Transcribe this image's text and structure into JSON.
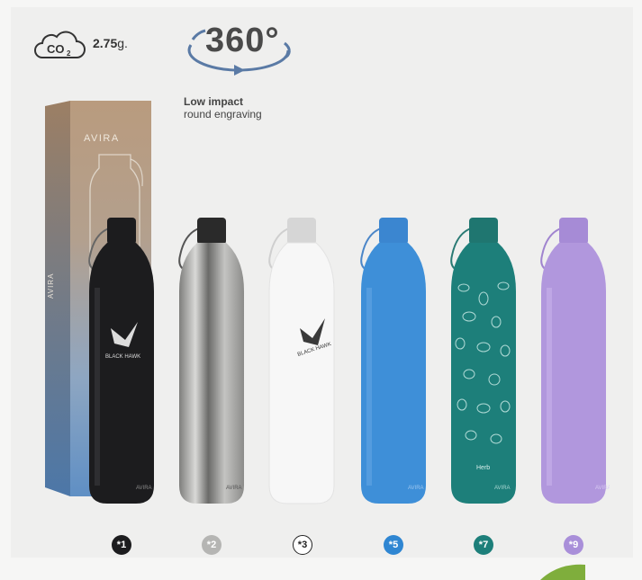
{
  "header": {
    "co2_icon": "co2-cloud-icon",
    "co2_value": "2.75",
    "co2_unit": "g.",
    "rotation_icon": "rotation-arrows-icon",
    "degrees": "360°",
    "impact_title": "Low impact",
    "impact_subtitle": "round engraving"
  },
  "packaging": {
    "brand": "AVIRA"
  },
  "bottles": [
    {
      "color_name": "black",
      "color": "#1c1c1e",
      "badge": "*1",
      "engraving": "BLACK HAWK",
      "brand": "AVIRA"
    },
    {
      "color_name": "stainless steel",
      "color": "#b5b5b3",
      "badge": "*2",
      "brand": "AVIRA"
    },
    {
      "color_name": "white",
      "color": "#f4f4f4",
      "badge": "*3",
      "engraving": "BLACK HAWK"
    },
    {
      "color_name": "blue",
      "color": "#3e8fd8",
      "badge": "*5",
      "brand": "AVIRA"
    },
    {
      "color_name": "teal",
      "color": "#1d7f7a",
      "badge": "*7",
      "brand": "AVIRA",
      "print_text": "Herb"
    },
    {
      "color_name": "lavender",
      "color": "#b197dd",
      "badge": "*9",
      "brand": "AVIRA"
    }
  ]
}
